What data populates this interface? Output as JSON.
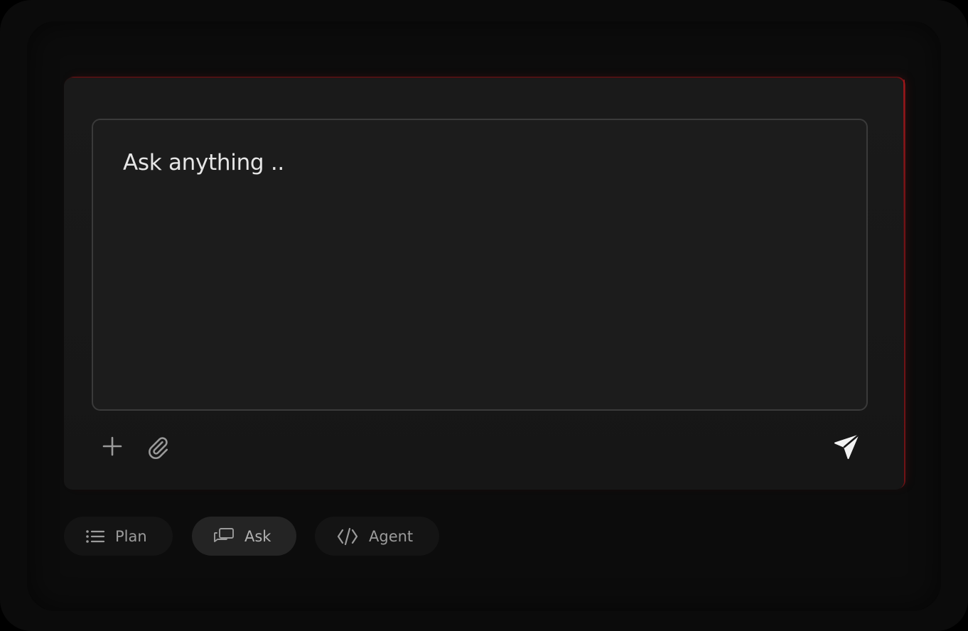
{
  "composer": {
    "placeholder": "Ask anything .."
  },
  "toolbar": {
    "add_icon": "plus-icon",
    "attach_icon": "paperclip-icon",
    "send_icon": "send-icon"
  },
  "modes": [
    {
      "label": "Plan",
      "icon": "list-icon"
    },
    {
      "label": "Ask",
      "icon": "chat-bubbles-icon",
      "selected": true
    },
    {
      "label": "Agent",
      "icon": "code-icon"
    }
  ],
  "colors": {
    "background": "#0b0b0b",
    "panel": "#1a1a1a",
    "editor": "#1c1c1c",
    "accent_glow": "#a0181c",
    "text": "#e6e6e6",
    "muted_text": "#9b9b9b"
  }
}
